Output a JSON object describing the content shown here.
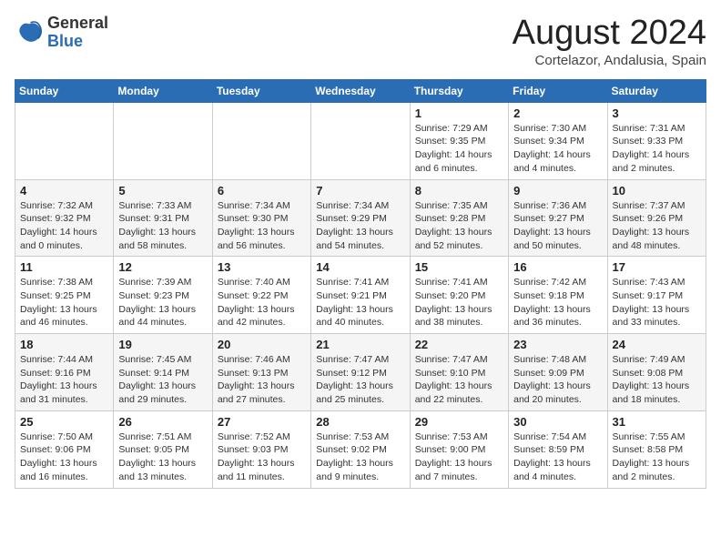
{
  "logo": {
    "general": "General",
    "blue": "Blue"
  },
  "header": {
    "month": "August 2024",
    "location": "Cortelazor, Andalusia, Spain"
  },
  "days_of_week": [
    "Sunday",
    "Monday",
    "Tuesday",
    "Wednesday",
    "Thursday",
    "Friday",
    "Saturday"
  ],
  "weeks": [
    [
      {
        "day": "",
        "detail": ""
      },
      {
        "day": "",
        "detail": ""
      },
      {
        "day": "",
        "detail": ""
      },
      {
        "day": "",
        "detail": ""
      },
      {
        "day": "1",
        "detail": "Sunrise: 7:29 AM\nSunset: 9:35 PM\nDaylight: 14 hours and 6 minutes."
      },
      {
        "day": "2",
        "detail": "Sunrise: 7:30 AM\nSunset: 9:34 PM\nDaylight: 14 hours and 4 minutes."
      },
      {
        "day": "3",
        "detail": "Sunrise: 7:31 AM\nSunset: 9:33 PM\nDaylight: 14 hours and 2 minutes."
      }
    ],
    [
      {
        "day": "4",
        "detail": "Sunrise: 7:32 AM\nSunset: 9:32 PM\nDaylight: 14 hours and 0 minutes."
      },
      {
        "day": "5",
        "detail": "Sunrise: 7:33 AM\nSunset: 9:31 PM\nDaylight: 13 hours and 58 minutes."
      },
      {
        "day": "6",
        "detail": "Sunrise: 7:34 AM\nSunset: 9:30 PM\nDaylight: 13 hours and 56 minutes."
      },
      {
        "day": "7",
        "detail": "Sunrise: 7:34 AM\nSunset: 9:29 PM\nDaylight: 13 hours and 54 minutes."
      },
      {
        "day": "8",
        "detail": "Sunrise: 7:35 AM\nSunset: 9:28 PM\nDaylight: 13 hours and 52 minutes."
      },
      {
        "day": "9",
        "detail": "Sunrise: 7:36 AM\nSunset: 9:27 PM\nDaylight: 13 hours and 50 minutes."
      },
      {
        "day": "10",
        "detail": "Sunrise: 7:37 AM\nSunset: 9:26 PM\nDaylight: 13 hours and 48 minutes."
      }
    ],
    [
      {
        "day": "11",
        "detail": "Sunrise: 7:38 AM\nSunset: 9:25 PM\nDaylight: 13 hours and 46 minutes."
      },
      {
        "day": "12",
        "detail": "Sunrise: 7:39 AM\nSunset: 9:23 PM\nDaylight: 13 hours and 44 minutes."
      },
      {
        "day": "13",
        "detail": "Sunrise: 7:40 AM\nSunset: 9:22 PM\nDaylight: 13 hours and 42 minutes."
      },
      {
        "day": "14",
        "detail": "Sunrise: 7:41 AM\nSunset: 9:21 PM\nDaylight: 13 hours and 40 minutes."
      },
      {
        "day": "15",
        "detail": "Sunrise: 7:41 AM\nSunset: 9:20 PM\nDaylight: 13 hours and 38 minutes."
      },
      {
        "day": "16",
        "detail": "Sunrise: 7:42 AM\nSunset: 9:18 PM\nDaylight: 13 hours and 36 minutes."
      },
      {
        "day": "17",
        "detail": "Sunrise: 7:43 AM\nSunset: 9:17 PM\nDaylight: 13 hours and 33 minutes."
      }
    ],
    [
      {
        "day": "18",
        "detail": "Sunrise: 7:44 AM\nSunset: 9:16 PM\nDaylight: 13 hours and 31 minutes."
      },
      {
        "day": "19",
        "detail": "Sunrise: 7:45 AM\nSunset: 9:14 PM\nDaylight: 13 hours and 29 minutes."
      },
      {
        "day": "20",
        "detail": "Sunrise: 7:46 AM\nSunset: 9:13 PM\nDaylight: 13 hours and 27 minutes."
      },
      {
        "day": "21",
        "detail": "Sunrise: 7:47 AM\nSunset: 9:12 PM\nDaylight: 13 hours and 25 minutes."
      },
      {
        "day": "22",
        "detail": "Sunrise: 7:47 AM\nSunset: 9:10 PM\nDaylight: 13 hours and 22 minutes."
      },
      {
        "day": "23",
        "detail": "Sunrise: 7:48 AM\nSunset: 9:09 PM\nDaylight: 13 hours and 20 minutes."
      },
      {
        "day": "24",
        "detail": "Sunrise: 7:49 AM\nSunset: 9:08 PM\nDaylight: 13 hours and 18 minutes."
      }
    ],
    [
      {
        "day": "25",
        "detail": "Sunrise: 7:50 AM\nSunset: 9:06 PM\nDaylight: 13 hours and 16 minutes."
      },
      {
        "day": "26",
        "detail": "Sunrise: 7:51 AM\nSunset: 9:05 PM\nDaylight: 13 hours and 13 minutes."
      },
      {
        "day": "27",
        "detail": "Sunrise: 7:52 AM\nSunset: 9:03 PM\nDaylight: 13 hours and 11 minutes."
      },
      {
        "day": "28",
        "detail": "Sunrise: 7:53 AM\nSunset: 9:02 PM\nDaylight: 13 hours and 9 minutes."
      },
      {
        "day": "29",
        "detail": "Sunrise: 7:53 AM\nSunset: 9:00 PM\nDaylight: 13 hours and 7 minutes."
      },
      {
        "day": "30",
        "detail": "Sunrise: 7:54 AM\nSunset: 8:59 PM\nDaylight: 13 hours and 4 minutes."
      },
      {
        "day": "31",
        "detail": "Sunrise: 7:55 AM\nSunset: 8:58 PM\nDaylight: 13 hours and 2 minutes."
      }
    ]
  ]
}
